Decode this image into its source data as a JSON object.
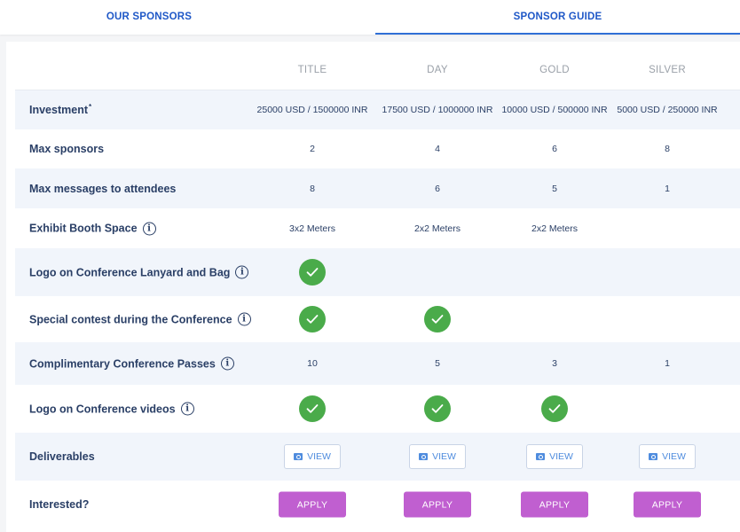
{
  "tabs": {
    "sponsors": "OUR SPONSORS",
    "guide": "SPONSOR GUIDE"
  },
  "columns": [
    "TITLE",
    "DAY",
    "GOLD",
    "SILVER"
  ],
  "rows": {
    "investment": {
      "label": "Investment",
      "marker": "*",
      "values": [
        "25000 USD / 1500000 INR",
        "17500 USD / 1000000 INR",
        "10000 USD / 500000 INR",
        "5000 USD / 250000 INR"
      ]
    },
    "max_sponsors": {
      "label": "Max sponsors",
      "values": [
        "2",
        "4",
        "6",
        "8"
      ]
    },
    "max_messages": {
      "label": "Max messages to attendees",
      "values": [
        "8",
        "6",
        "5",
        "1"
      ]
    },
    "booth": {
      "label": "Exhibit Booth Space",
      "values": [
        "3x2 Meters",
        "2x2 Meters",
        "2x2 Meters",
        ""
      ]
    },
    "lanyard": {
      "label": "Logo on Conference Lanyard and Bag",
      "checks": [
        true,
        false,
        false,
        false
      ]
    },
    "contest": {
      "label": "Special contest during the Conference",
      "checks": [
        true,
        true,
        false,
        false
      ]
    },
    "passes": {
      "label": "Complimentary Conference Passes",
      "values": [
        "10",
        "5",
        "3",
        "1"
      ]
    },
    "videos": {
      "label": "Logo on Conference videos",
      "checks": [
        true,
        true,
        true,
        false
      ]
    },
    "deliverables": {
      "label": "Deliverables",
      "button": "VIEW"
    },
    "interested": {
      "label": "Interested?",
      "button": "APPLY"
    }
  },
  "colors": {
    "accent": "#1f58c7",
    "check": "#4aab4a",
    "apply": "#c05fd0",
    "label": "#2a3f66"
  },
  "icons": {
    "info": "info-circle-icon",
    "check": "checkmark-icon",
    "view": "image-search-icon"
  }
}
